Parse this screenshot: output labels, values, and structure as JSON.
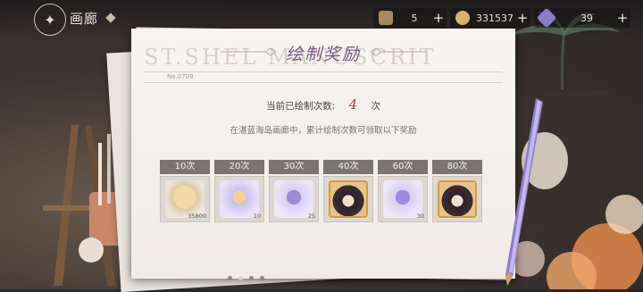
{
  "header": {
    "title": "画廊",
    "resources": [
      {
        "value": "5",
        "icon": "character-icon",
        "color": "#a88860"
      },
      {
        "value": "331537",
        "icon": "coin-icon",
        "color": "#d8b46a"
      },
      {
        "value": "39",
        "icon": "gem-icon",
        "color": "#8a7cc9"
      }
    ]
  },
  "panel": {
    "watermark": "ST.SHEL  MANUSCRIT",
    "title": "绘制奖励",
    "doc_no": "No.0709",
    "count_label": "当前已绘制次数:",
    "count_value": "4",
    "count_unit": "次",
    "description": "在湛蓝海岛画廊中，累计绘制次数可领取以下奖励"
  },
  "rewards": [
    {
      "label": "10次",
      "item": "gold-bar-icon",
      "qty": "35800",
      "color": "#d8b070"
    },
    {
      "label": "20次",
      "item": "sun-medal-icon",
      "qty": "10",
      "color": "#b9aee8"
    },
    {
      "label": "30次",
      "item": "butterfly-crystal-icon",
      "qty": "25",
      "color": "#b7a6e6"
    },
    {
      "label": "40次",
      "item": "character-portrait-icon",
      "qty": "",
      "color": "#d79a3c"
    },
    {
      "label": "60次",
      "item": "butterfly-crystal-icon",
      "qty": "30",
      "color": "#b7a6e6"
    },
    {
      "label": "80次",
      "item": "character-portrait-icon",
      "qty": "",
      "color": "#d79a3c"
    }
  ],
  "accent": {
    "title": "#7a5b83",
    "count": "#b23b3b"
  }
}
